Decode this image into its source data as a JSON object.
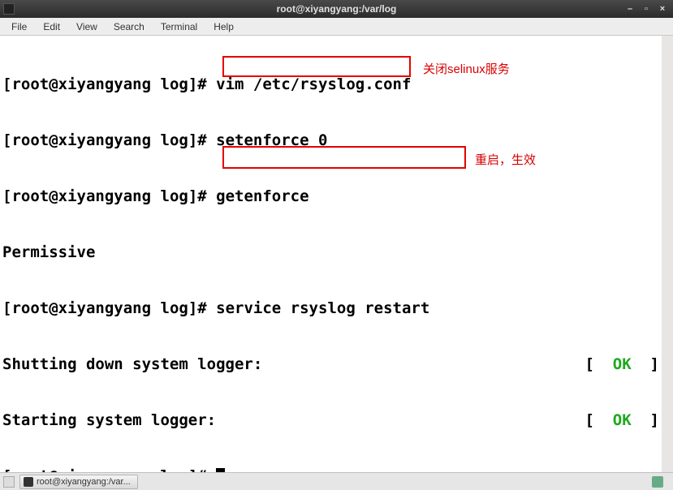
{
  "window": {
    "title": "root@xiyangyang:/var/log"
  },
  "menubar": [
    "File",
    "Edit",
    "View",
    "Search",
    "Terminal",
    "Help"
  ],
  "prompt_parts": {
    "user": "root",
    "host": "xiyangyang",
    "cwd": "log"
  },
  "lines": {
    "cmd1": "vim /etc/rsyslog.conf",
    "cmd2": "setenforce 0",
    "cmd3": "getenforce",
    "out3": "Permissive",
    "cmd4": "service rsyslog restart",
    "out4a_text": "Shutting down system logger:",
    "out4b_text": "Starting system logger:",
    "ok": "OK"
  },
  "annotations": {
    "a1": "关闭selinux服务",
    "a2": "重启，生效"
  },
  "taskbar": {
    "item": "root@xiyangyang:/var..."
  }
}
